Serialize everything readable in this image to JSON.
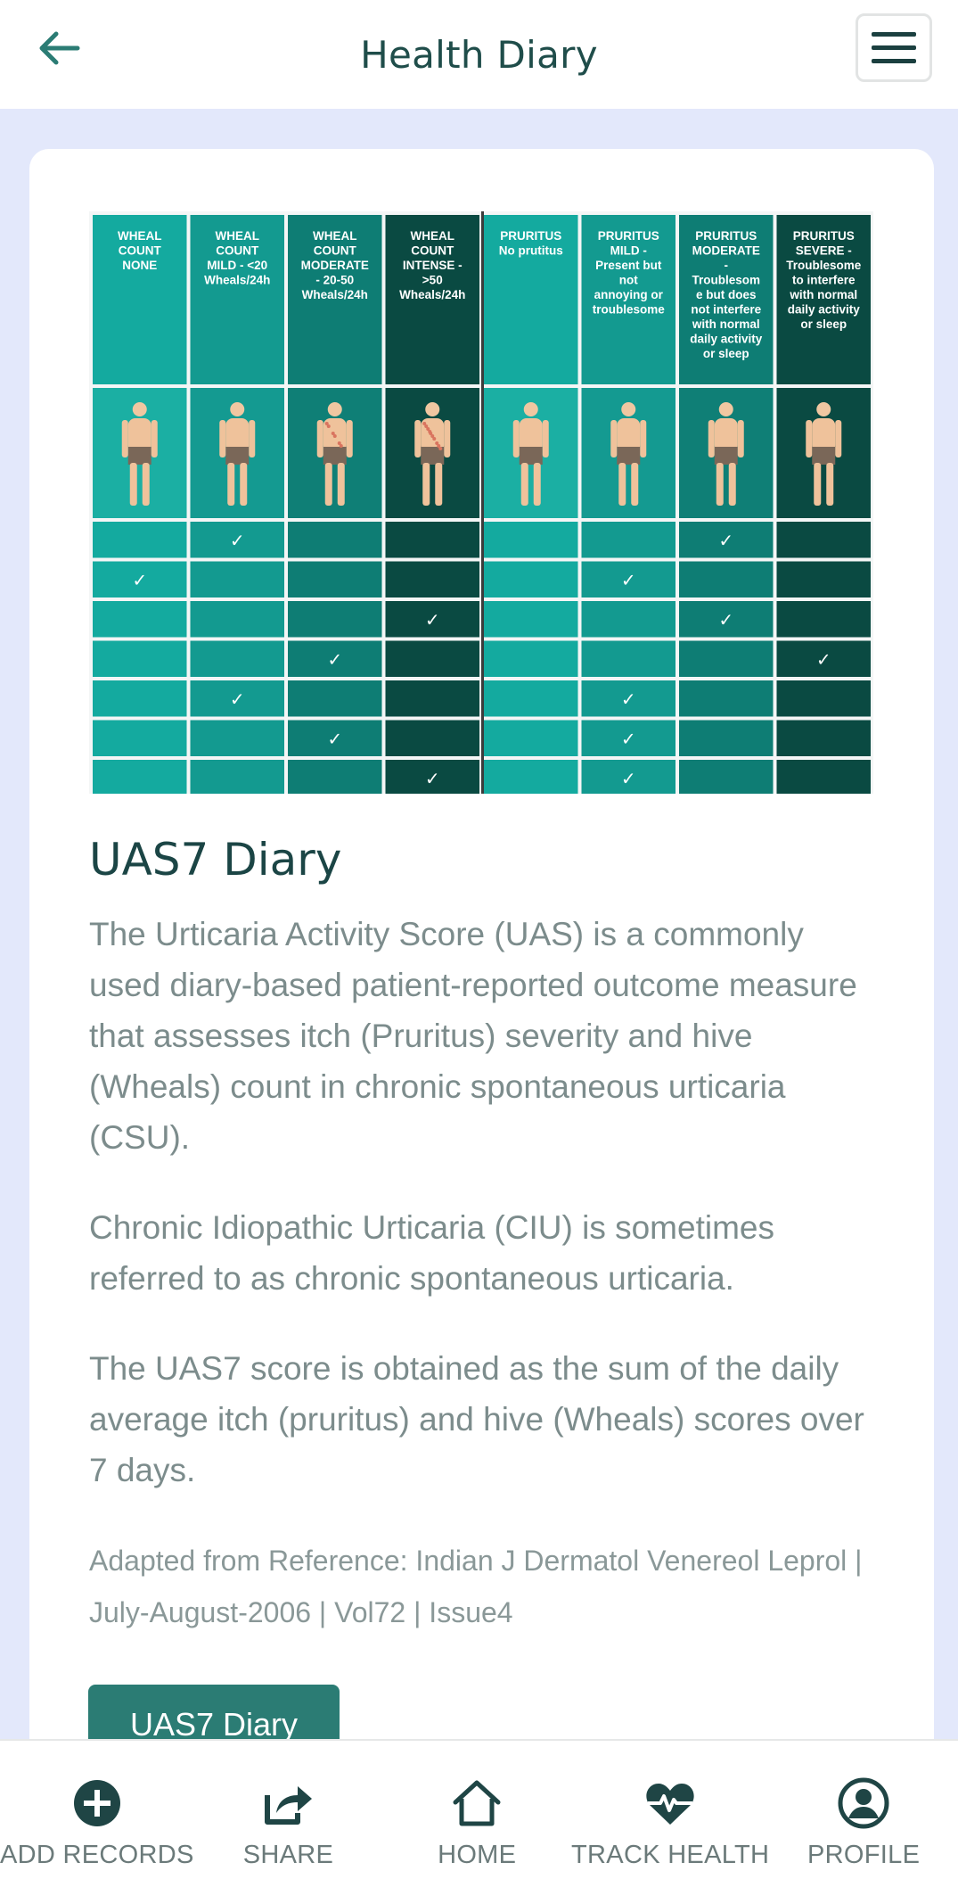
{
  "header": {
    "title": "Health Diary"
  },
  "grid": {
    "columns": [
      {
        "label": "WHEAL COUNT NONE",
        "lines": [
          "WHEAL",
          "COUNT",
          "NONE"
        ],
        "color": "#14aa9f",
        "body_color": "#1bafa3",
        "marks": "none"
      },
      {
        "label": "WHEAL COUNT MILD - <20 Wheals/24h",
        "lines": [
          "WHEAL",
          "COUNT",
          "MILD - <20",
          "Wheals/24h"
        ],
        "color": "#139a90",
        "body_color": "#149a91",
        "marks": "few"
      },
      {
        "label": "WHEAL COUNT MODERATE - 20-50 Wheals/24h",
        "lines": [
          "WHEAL",
          "COUNT",
          "MODERATE",
          "- 20-50",
          "Wheals/24h"
        ],
        "color": "#0e7d74",
        "body_color": "#0f7f76",
        "marks": "some"
      },
      {
        "label": "WHEAL COUNT INTENSE - >50 Wheals/24h",
        "lines": [
          "WHEAL",
          "COUNT",
          "INTENSE -",
          ">50",
          "Wheals/24h"
        ],
        "color": "#0a4a42",
        "body_color": "#0a4a42",
        "marks": "many"
      },
      {
        "label": "PRURITUS No prutitus",
        "lines": [
          "PRURITUS",
          "No prutitus"
        ],
        "color": "#14aa9f",
        "body_color": "#1bafa3",
        "marks": "none"
      },
      {
        "label": "PRURITUS MILD - Present but not annoying or troublesome",
        "lines": [
          "PRURITUS",
          "MILD -",
          "Present but",
          "not",
          "annoying or",
          "troublesome"
        ],
        "color": "#139a90",
        "body_color": "#149a91",
        "marks": "none"
      },
      {
        "label": "PRURITUS MODERATE - Troublesome but does not interfere with normal daily activity or sleep",
        "lines": [
          "PRURITUS",
          "MODERATE",
          "-",
          "Troublesom",
          "e but does",
          "not interfere",
          "with normal",
          "daily activity",
          "or sleep"
        ],
        "color": "#0e7d74",
        "body_color": "#0f7f76",
        "marks": "none"
      },
      {
        "label": "PRURITUS SEVERE - Troublesome to interfere with normal daily activity or sleep",
        "lines": [
          "PRURITUS",
          "SEVERE -",
          "Troublesome",
          "to interfere",
          "with normal",
          "daily activity",
          "or sleep"
        ],
        "color": "#0a4a42",
        "body_color": "#0a4a42",
        "marks": "none"
      }
    ],
    "check_rows": [
      [
        1,
        6
      ],
      [
        0,
        5
      ],
      [
        3,
        6
      ],
      [
        2,
        7
      ],
      [
        1,
        5
      ],
      [
        2,
        5
      ],
      [
        3,
        5
      ]
    ],
    "check_glyph": "✓"
  },
  "content": {
    "title": "UAS7 Diary",
    "paragraphs": [
      "The Urticaria Activity Score (UAS) is a commonly used diary-based patient-reported outcome measure that assesses itch (Pruritus) severity and hive (Wheals) count in chronic spontaneous urticaria (CSU).",
      "Chronic Idiopathic Urticaria (CIU) is sometimes referred to as chronic spontaneous urticaria.",
      "The UAS7 score is obtained as the sum of the daily average itch (pruritus) and hive (Wheals) scores over 7 days."
    ],
    "reference": "Adapted from Reference: Indian J Dermatol Venereol Leprol | July-August-2006 | Vol72 | Issue4",
    "cta_label": "UAS7 Diary"
  },
  "bottom_nav": [
    {
      "label": "ADD RECORDS",
      "icon": "plus-circle-icon"
    },
    {
      "label": "SHARE",
      "icon": "share-icon"
    },
    {
      "label": "HOME",
      "icon": "home-icon"
    },
    {
      "label": "TRACK HEALTH",
      "icon": "heartbeat-icon"
    },
    {
      "label": "PROFILE",
      "icon": "profile-icon"
    }
  ],
  "colors": {
    "accent": "#2b7c74",
    "title": "#1f4d4a",
    "background": "#e3e8fb"
  }
}
